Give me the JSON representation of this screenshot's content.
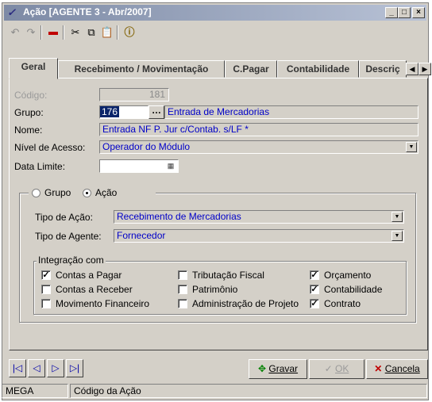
{
  "window": {
    "title": "Ação [AGENTE 3 - Abr/2007]",
    "app_icon": "mega-logo-icon",
    "controls": {
      "minimize": "_",
      "maximize": "□",
      "close": "×"
    }
  },
  "toolbar": {
    "icons": [
      "undo-icon",
      "redo-icon",
      "delete-icon",
      "cut-icon",
      "copy-icon",
      "paste-icon",
      "info-icon"
    ]
  },
  "tabs": [
    {
      "label": "Geral"
    },
    {
      "label": "Recebimento / Movimentação"
    },
    {
      "label": "C.Pagar"
    },
    {
      "label": "Contabilidade"
    },
    {
      "label": "Descriç"
    }
  ],
  "form": {
    "codigo_label": "Código:",
    "codigo_value": "181",
    "grupo_label": "Grupo:",
    "grupo_value": "176",
    "grupo_desc": "Entrada de Mercadorias",
    "nome_label": "Nome:",
    "nome_value": "Entrada NF P. Jur c/Contab. s/LF *",
    "nivel_label": "Nível de Acesso:",
    "nivel_value": "Operador do Módulo",
    "data_label": "Data Limite:",
    "data_value": ""
  },
  "mode": {
    "grupo_label": "Grupo",
    "acao_label": "Ação",
    "selected": "Ação",
    "tipo_acao_label": "Tipo de Ação:",
    "tipo_acao_value": "Recebimento de Mercadorias",
    "tipo_agente_label": "Tipo de Agente:",
    "tipo_agente_value": "Fornecedor"
  },
  "integracao": {
    "title": "Integração com",
    "items": [
      {
        "label": "Contas a Pagar",
        "checked": true
      },
      {
        "label": "Contas a Receber",
        "checked": false
      },
      {
        "label": "Movimento Financeiro",
        "checked": false
      },
      {
        "label": "Tributação Fiscal",
        "checked": false
      },
      {
        "label": "Patrimônio",
        "checked": false
      },
      {
        "label": "Administração de Projeto",
        "checked": false
      },
      {
        "label": "Orçamento",
        "checked": true
      },
      {
        "label": "Contabilidade",
        "checked": true
      },
      {
        "label": "Contrato",
        "checked": true
      }
    ]
  },
  "buttons": {
    "gravar": "Gravar",
    "ok": "OK",
    "cancelar": "Cancela"
  },
  "statusbar": {
    "module": "MEGA",
    "hint": "Código da Ação"
  }
}
